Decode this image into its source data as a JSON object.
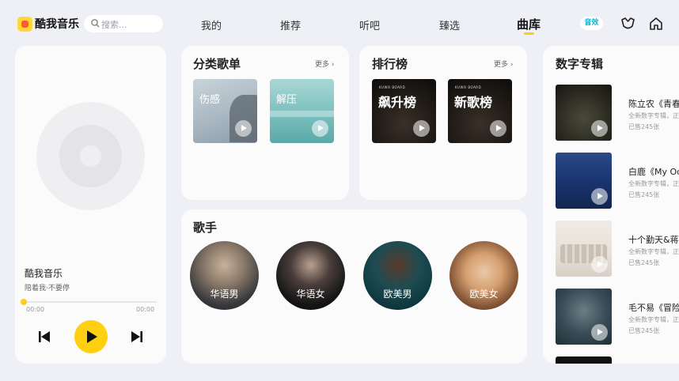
{
  "header": {
    "app_title": "酷我音乐",
    "search_placeholder": "搜索...",
    "tabs": [
      "我的",
      "推荐",
      "听吧",
      "臻选",
      "曲库"
    ],
    "sound_badge": "音效"
  },
  "player": {
    "song_title": "酷我音乐",
    "artist": "陪着我·不要停",
    "time_current": "00:00",
    "time_total": "00:00",
    "progress": 0
  },
  "categories": {
    "title": "分类歌单",
    "more": "更多",
    "items": [
      {
        "label": "伤感"
      },
      {
        "label": "解压"
      }
    ]
  },
  "charts": {
    "title": "排行榜",
    "more": "更多",
    "items": [
      {
        "label": "飙升榜",
        "sub": "KUWO BOARD"
      },
      {
        "label": "新歌榜",
        "sub": "KUWO BOARD"
      }
    ]
  },
  "singers": {
    "title": "歌手",
    "items": [
      {
        "label": "华语男"
      },
      {
        "label": "华语女"
      },
      {
        "label": "欧美男"
      },
      {
        "label": "欧美女"
      }
    ]
  },
  "albums": {
    "title": "数字专辑",
    "items": [
      {
        "title": "陈立农《青春",
        "desc": "全新数字专辑，正",
        "sold": "已售245张"
      },
      {
        "title": "白鹿《My Od",
        "desc": "全新数字专辑，正",
        "sold": "已售245张"
      },
      {
        "title": "十个勤天&蒋",
        "desc": "全新数字专辑，正",
        "sold": "已售245张"
      },
      {
        "title": "毛不易《冒险",
        "desc": "全新数字专辑，正",
        "sold": "已售245张"
      }
    ]
  },
  "colors": {
    "accent": "#ffd012",
    "background": "#eef0f5",
    "card": "#fbfbfc",
    "sound_badge_text": "#0cb6d1"
  }
}
